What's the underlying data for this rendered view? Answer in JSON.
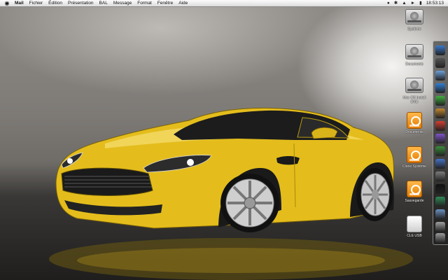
{
  "menubar": {
    "apple_glyph": "",
    "menus": [
      "Mail",
      "Fichier",
      "Édition",
      "Présentation",
      "BAL",
      "Message",
      "Format",
      "Fenêtre",
      "Aide"
    ],
    "status_icons": [
      "spotlight-icon",
      "bluetooth-icon",
      "wifi-icon",
      "volume-icon",
      "battery-icon"
    ],
    "clock": "18:53:13"
  },
  "desktop_icons": [
    {
      "label": "Système",
      "type": "hard-disk"
    },
    {
      "label": "Documents",
      "type": "hard-disk"
    },
    {
      "label": "Mac OS Install DVD",
      "type": "hard-disk"
    },
    {
      "label": "Documents",
      "type": "external-disk"
    },
    {
      "label": "Clone Système",
      "type": "external-disk"
    },
    {
      "label": "Sauvegarde",
      "type": "external-disk"
    },
    {
      "label": "CLE USB",
      "type": "usb-disk"
    }
  ],
  "dock": {
    "items": [
      "finder",
      "dashboard",
      "mail",
      "safari",
      "ichat",
      "address-book",
      "ical",
      "itunes",
      "iphoto",
      "imovie",
      "system-preferences",
      "terminal",
      "activity-monitor",
      "preview",
      "automator",
      "trash"
    ],
    "colors": [
      "#3a78c9",
      "#555555",
      "#6a9fd8",
      "#2f7fd6",
      "#3fae3f",
      "#c0872f",
      "#d63b2f",
      "#7f53c9",
      "#3a8c3a",
      "#4472c4",
      "#7b7b7b",
      "#111111",
      "#2e8b57",
      "#6b8fbf",
      "#a0a0a0",
      "#9a9a9a"
    ]
  },
  "wallpaper": {
    "subject": "yellow sports car",
    "car_color": "#e8c21a"
  }
}
